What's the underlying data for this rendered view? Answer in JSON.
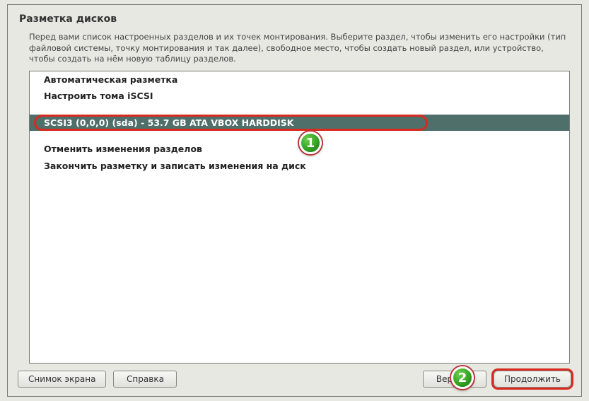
{
  "title": "Разметка дисков",
  "description": "Перед вами список настроенных разделов и их точек монтирования. Выберите раздел, чтобы изменить его настройки (тип файловой системы, точку монтирования и так далее), свободное место, чтобы создать новый раздел, или устройство, чтобы создать на нём новую таблицу разделов.",
  "list": {
    "auto": "Автоматическая разметка",
    "iscsi": "Настроить тома iSCSI",
    "disk": "SCSI3 (0,0,0) (sda) - 53.7 GB ATA VBOX HARDDISK",
    "undo": "Отменить изменения разделов",
    "finish": "Закончить разметку и записать изменения на диск"
  },
  "buttons": {
    "screenshot": "Снимок экрана",
    "help": "Справка",
    "back": "Вернуть",
    "continue": "Продолжить"
  },
  "badges": {
    "one": "1",
    "two": "2"
  }
}
